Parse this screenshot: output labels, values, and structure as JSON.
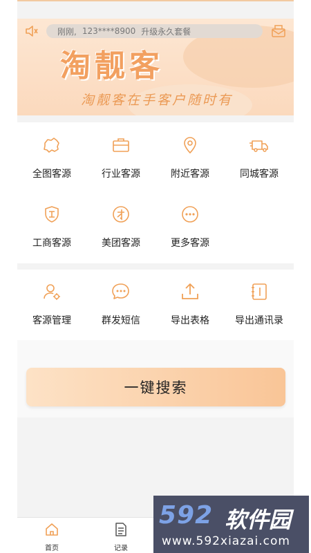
{
  "banner": {
    "notice": {
      "time": "刚刚,",
      "phone": "123****8900",
      "action": "升级永久套餐"
    },
    "brand": "淘靓客",
    "slogan": "淘靓客在手客户随时有"
  },
  "colors": {
    "accent": "#f0a056",
    "button_gradient": [
      "#fde2c6",
      "#f9c597"
    ]
  },
  "grid_top": [
    {
      "label": "全图客源",
      "icon": "map-icon"
    },
    {
      "label": "行业客源",
      "icon": "briefcase-icon"
    },
    {
      "label": "附近客源",
      "icon": "location-pin-icon"
    },
    {
      "label": "同城客源",
      "icon": "delivery-truck-icon"
    },
    {
      "label": "工商客源",
      "icon": "business-shield-icon"
    },
    {
      "label": "美团客源",
      "icon": "meituan-icon"
    },
    {
      "label": "更多客源",
      "icon": "more-dots-icon"
    }
  ],
  "grid_tools": [
    {
      "label": "客源管理",
      "icon": "user-manage-icon"
    },
    {
      "label": "群发短信",
      "icon": "chat-bubble-icon"
    },
    {
      "label": "导出表格",
      "icon": "upload-icon"
    },
    {
      "label": "导出通讯录",
      "icon": "address-book-icon"
    }
  ],
  "search_button": "一键搜索",
  "tabs": [
    {
      "label": "首页",
      "icon": "home-icon"
    },
    {
      "label": "记录",
      "icon": "document-icon"
    }
  ],
  "watermark": {
    "logo": "592",
    "name": "软件园",
    "url": "www.592xiazai.com"
  }
}
